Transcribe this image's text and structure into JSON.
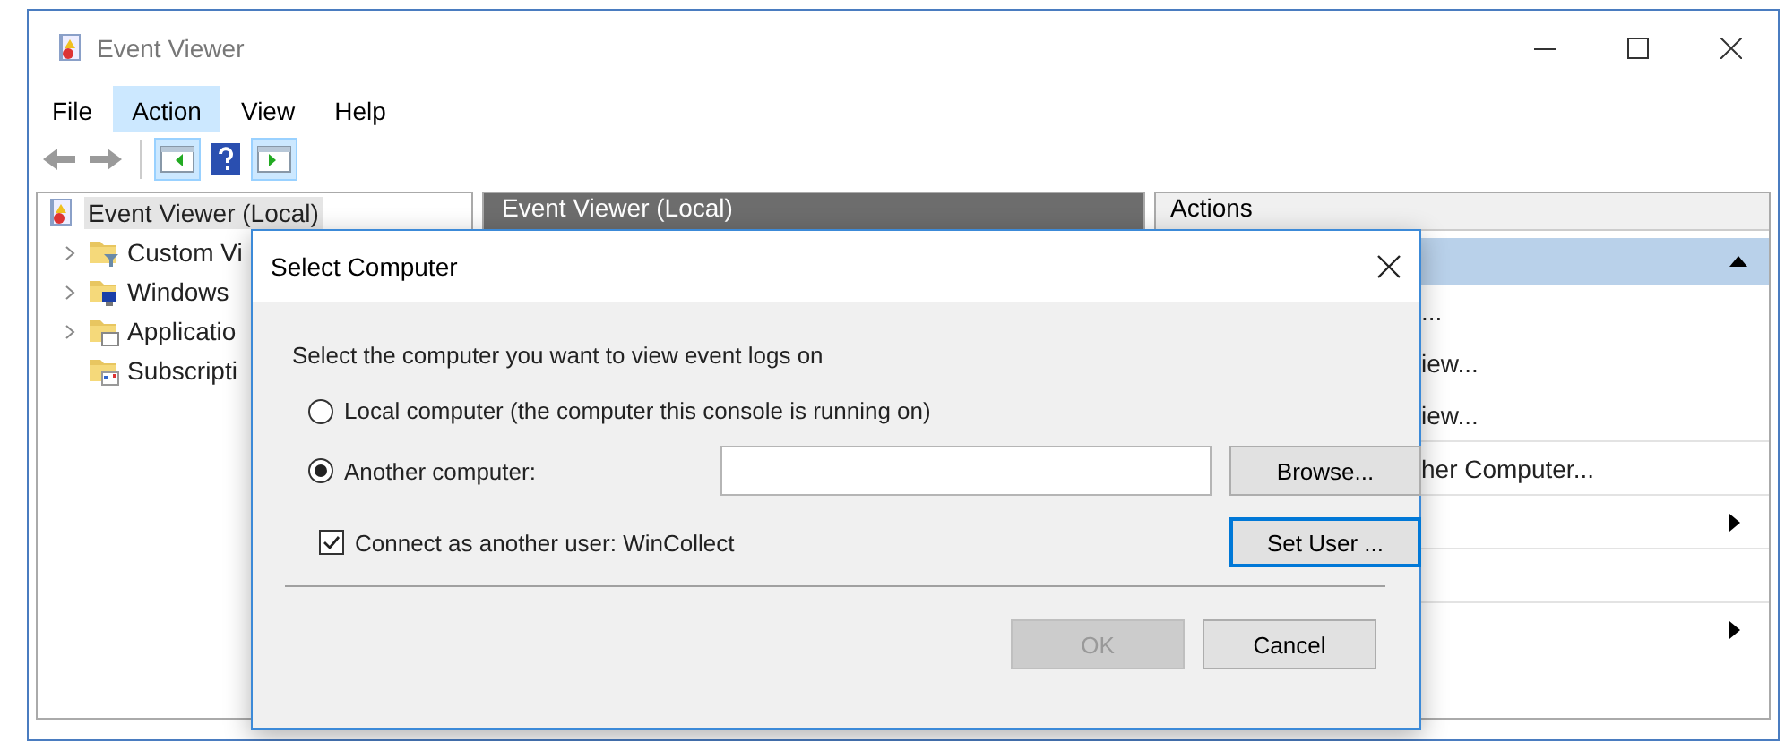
{
  "window": {
    "title": "Event Viewer"
  },
  "menu": [
    {
      "label": "File",
      "selected": false
    },
    {
      "label": "Action",
      "selected": true
    },
    {
      "label": "View",
      "selected": false
    },
    {
      "label": "Help",
      "selected": false
    }
  ],
  "toolbar": [
    {
      "kind": "back",
      "enabled": false,
      "selected": false
    },
    {
      "kind": "forward",
      "enabled": false,
      "selected": false
    },
    {
      "kind": "separator"
    },
    {
      "kind": "tree-pane",
      "selected": true
    },
    {
      "kind": "help",
      "selected": false
    },
    {
      "kind": "action-pane",
      "selected": true
    }
  ],
  "tree": [
    {
      "label": "Event Viewer (Local)",
      "kind": "root",
      "selected": true,
      "children": [
        {
          "label": "Custom Vi",
          "kind": "filter-folder",
          "expandable": true,
          "selected": false
        },
        {
          "label": "Windows",
          "kind": "windows-folder",
          "expandable": true,
          "selected": false
        },
        {
          "label": "Applicatio",
          "kind": "app-folder",
          "expandable": true,
          "selected": false
        },
        {
          "label": "Subscripti",
          "kind": "subscription-folder",
          "expandable": false,
          "selected": false
        }
      ]
    }
  ],
  "center": {
    "header": "Event Viewer (Local)"
  },
  "actions": {
    "header": "Actions",
    "expanded": true,
    "items": [
      {
        "kind": "text",
        "label": "...",
        "separator_after": false
      },
      {
        "kind": "text",
        "label": "iew...",
        "separator_after": false
      },
      {
        "kind": "text",
        "label": "iew...",
        "separator_after": true
      },
      {
        "kind": "text",
        "label": "her Computer...",
        "separator_after": true
      },
      {
        "kind": "submenu",
        "separator_after": true
      },
      {
        "kind": "blank",
        "separator_after": true
      },
      {
        "kind": "submenu",
        "separator_after": false
      }
    ]
  },
  "dialog": {
    "title": "Select Computer",
    "prompt": "Select the computer you want to view event logs on",
    "options": [
      {
        "label": "Local computer (the computer this console is running on)",
        "selected": false
      },
      {
        "label": "Another computer:",
        "selected": true
      }
    ],
    "browse_button": {
      "label": "Browse...",
      "focused": false
    },
    "connect_as": {
      "label": "Connect as another user: WinCollect",
      "checked": true
    },
    "set_user_button": {
      "label": "Set User ...",
      "focused": true
    },
    "buttons": [
      {
        "label": "OK",
        "disabled": true
      },
      {
        "label": "Cancel",
        "disabled": false
      }
    ]
  }
}
